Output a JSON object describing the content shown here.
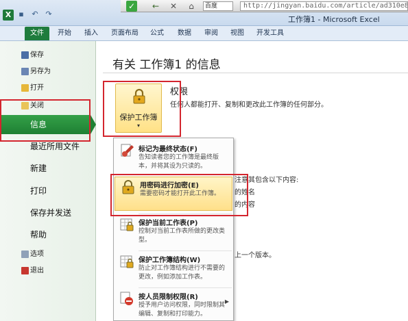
{
  "window": {
    "title": "工作簿1 - Microsoft Excel",
    "app_logo": "X"
  },
  "browser": {
    "search_label": "百度",
    "url": "http://jingyan.baidu.com/article/ad310e80b"
  },
  "ribbon": {
    "tabs": [
      {
        "label": "文件"
      },
      {
        "label": "开始"
      },
      {
        "label": "插入"
      },
      {
        "label": "页面布局"
      },
      {
        "label": "公式"
      },
      {
        "label": "数据"
      },
      {
        "label": "审阅"
      },
      {
        "label": "视图"
      },
      {
        "label": "开发工具"
      }
    ]
  },
  "nav": {
    "small_items": [
      {
        "label": "保存",
        "icon": "save-icon"
      },
      {
        "label": "另存为",
        "icon": "save-as-icon"
      },
      {
        "label": "打开",
        "icon": "open-folder-icon"
      },
      {
        "label": "关闭",
        "icon": "close-folder-icon"
      }
    ],
    "info_label": "信息",
    "big_items": [
      {
        "label": "最近所用文件"
      },
      {
        "label": "新建"
      },
      {
        "label": "打印"
      },
      {
        "label": "保存并发送"
      },
      {
        "label": "帮助"
      }
    ],
    "bottom_items": [
      {
        "label": "选项",
        "icon": "options-icon"
      },
      {
        "label": "退出",
        "icon": "exit-icon"
      }
    ]
  },
  "info": {
    "title": "有关 工作簿1 的信息",
    "protect_button": {
      "label": "保护工作簿",
      "dropdown": "▾"
    },
    "permissions": {
      "title": "权限",
      "description": "任何人都能打开、复制和更改此工作簿的任何部分。"
    },
    "partial_texts": [
      "注意其包含以下内容:",
      "的姓名",
      "的内容",
      "上一个版本。"
    ]
  },
  "protect_menu": {
    "items": [
      {
        "title": "标记为最终状态(F)",
        "description": "告知读者您的工作簿是最终版本，并将其设为只读的。",
        "icon": "final-stamp-icon"
      },
      {
        "title": "用密码进行加密(E)",
        "description": "需要密码才能打开此工作簿。",
        "icon": "padlock-icon"
      },
      {
        "title": "保护当前工作表(P)",
        "description": "控制对当前工作表所做的更改类型。",
        "icon": "protect-sheet-icon"
      },
      {
        "title": "保护工作簿结构(W)",
        "description": "防止对工作簿结构进行不需要的更改，例如添加工作表。",
        "icon": "protect-structure-icon"
      },
      {
        "title": "按人员限制权限(R)",
        "description": "授予用户访问权限，同时限制其编辑、复制和打印能力。",
        "icon": "restrict-permission-icon"
      }
    ]
  },
  "colors": {
    "file_tab": "#1f7c3d",
    "info_selected": "#1e8033",
    "highlight_box": "#d3252e",
    "hover_fill": "#ffe08a"
  }
}
